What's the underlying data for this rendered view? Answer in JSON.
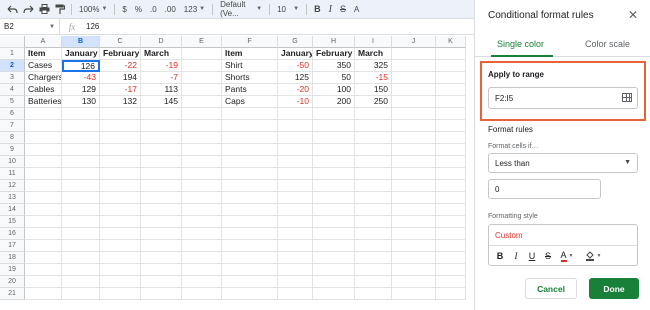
{
  "toolbar": {
    "zoom": "100%",
    "currency": "$",
    "percent": "%",
    "decrease_decimal": ".0",
    "increase_decimal": ".00",
    "number_format": "123",
    "font": "Default (Ve...",
    "font_size": "10",
    "bold": "B",
    "italic": "I",
    "strike": "S",
    "text_color": "A"
  },
  "formula_bar": {
    "cell_ref": "B2",
    "fx": "fx",
    "value": "126"
  },
  "sheet": {
    "columns": [
      "A",
      "B",
      "C",
      "D",
      "E",
      "F",
      "G",
      "H",
      "I",
      "J",
      "K"
    ],
    "rows": [
      "1",
      "2",
      "3",
      "4",
      "5",
      "6",
      "7",
      "8",
      "9",
      "10",
      "11",
      "12",
      "13",
      "14",
      "15",
      "16",
      "17",
      "18",
      "19",
      "20",
      "21"
    ],
    "table1": {
      "headers": [
        "Item",
        "January",
        "February",
        "March"
      ],
      "data": [
        [
          "Cases",
          "126",
          "-22",
          "-19"
        ],
        [
          "Chargers",
          "-43",
          "194",
          "-7"
        ],
        [
          "Cables",
          "129",
          "-17",
          "113"
        ],
        [
          "Batteries",
          "130",
          "132",
          "145"
        ]
      ]
    },
    "table2": {
      "headers": [
        "Item",
        "January",
        "February",
        "March"
      ],
      "data": [
        [
          "Shirt",
          "-50",
          "350",
          "325"
        ],
        [
          "Shorts",
          "125",
          "50",
          "-15"
        ],
        [
          "Pants",
          "-20",
          "100",
          "150"
        ],
        [
          "Caps",
          "-10",
          "200",
          "250"
        ]
      ]
    },
    "negative_color": "#d93025"
  },
  "panel": {
    "title": "Conditional format rules",
    "close_icon": "close-icon",
    "tabs": [
      "Single color",
      "Color scale"
    ],
    "apply_to_range_label": "Apply to range",
    "range_value": "F2:I5",
    "format_rules_label": "Format rules",
    "format_cells_if_label": "Format cells if…",
    "condition": "Less than",
    "condition_value": "0",
    "formatting_style_label": "Formatting style",
    "style_name": "Custom",
    "style_buttons": [
      "B",
      "I",
      "U",
      "S",
      "A"
    ],
    "cancel_label": "Cancel",
    "done_label": "Done",
    "accent_color": "#188038",
    "highlight_color": "#e8623a"
  }
}
